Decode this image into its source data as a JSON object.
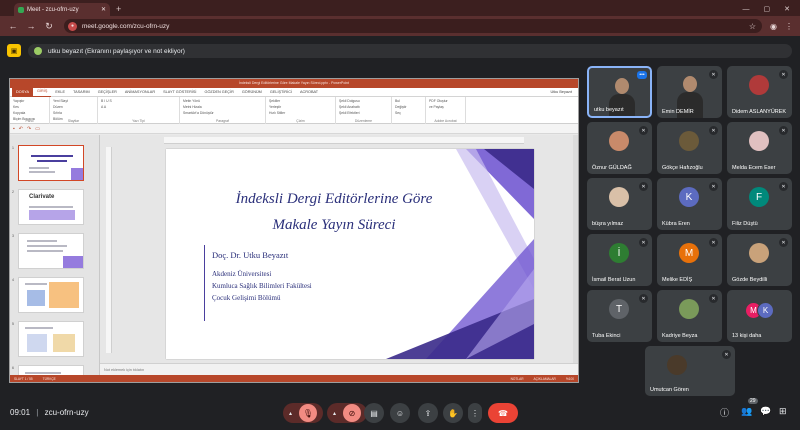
{
  "browser": {
    "tab_title": "Meet - zcu-ofrn-uzy",
    "url": "meet.google.com/zcu-ofrn-uzy",
    "new_tab": "+",
    "minimize": "—",
    "maximize": "▢",
    "close": "✕"
  },
  "banner": {
    "text": "utku beyazıt (Ekranını paylaşıyor ve not ekliyor)"
  },
  "ppt": {
    "window_title": "İndeksli Dergi Editörlerine Göre Makale Yayın Süreci.pptx - PowerPoint",
    "tabs": [
      "DOSYA",
      "GİRİŞ",
      "EKLE",
      "TASARIM",
      "GEÇİŞLER",
      "ANİMASYONLAR",
      "SLAYT GÖSTERİSİ",
      "GÖZDEN GEÇİR",
      "GÖRÜNÜM",
      "GELİŞTİRİCİ",
      "ACROBAT"
    ],
    "user": "Utku Beyazıt",
    "ribbon_groups": [
      {
        "label": "Pano",
        "items": [
          "Yapıştır",
          "Kes",
          "Kopyala",
          "Biçim Boyacısı"
        ]
      },
      {
        "label": "Slaytlar",
        "items": [
          "Yeni Slayt",
          "Düzen",
          "Sıfırla",
          "Bölüm"
        ]
      },
      {
        "label": "Yazı Tipi",
        "items": [
          "B  I  U  S",
          "A  A"
        ]
      },
      {
        "label": "Paragraf",
        "items": [
          "Metin Yönü",
          "Metni Hizala",
          "SmartArt'a Dönüştür"
        ]
      },
      {
        "label": "Çizim",
        "items": [
          "Şekiller",
          "Yerleştir",
          "Hızlı Stiller"
        ]
      },
      {
        "label": "Düzenleme",
        "items": [
          "Şekil Dolgusu",
          "Şekil Anahattı",
          "Şekil Efektleri"
        ]
      },
      {
        "label": "",
        "items": [
          "Bul",
          "Değiştir",
          "Seç"
        ]
      },
      {
        "label": "Adobe Acrobat",
        "items": [
          "PDF Oluştur",
          "ve Paylaş"
        ]
      }
    ],
    "slide": {
      "title_line1": "İndeksli Dergi Editörlerine Göre",
      "title_line2": "Makale Yayın Süreci",
      "author": "Doç. Dr. Utku Beyazıt",
      "inst_line1": "Akdeniz Üniversitesi",
      "inst_line2": "Kumluca Sağlık Bilimleri Fakültesi",
      "inst_line3": "Çocuk Gelişimi Bölümü"
    },
    "thumb_nums": [
      "1",
      "2",
      "3",
      "4",
      "5",
      "6"
    ],
    "thumb2_brand": "Clarivate",
    "notes_placeholder": "Not eklemek için tıklatın",
    "status_left": "SLAYT 1 / 55",
    "status_lang": "TÜRKÇE",
    "status_notes": "NOTLAR",
    "status_comments": "AÇIKLAMALAR",
    "status_zoom": "%100"
  },
  "participants": [
    {
      "name": "utku beyazıt",
      "type": "video",
      "muted": false
    },
    {
      "name": "Emin DEMİR",
      "type": "video",
      "muted": true
    },
    {
      "name": "Didem ASLANYÜREK",
      "type": "photo",
      "muted": true,
      "color": "#b03a3a"
    },
    {
      "name": "Öznur GÜLDAĞ",
      "type": "photo",
      "muted": true,
      "color": "#c98a6a"
    },
    {
      "name": "Gökçe Hafızoğlu",
      "type": "photo",
      "muted": true,
      "color": "#6b5a3a"
    },
    {
      "name": "Melda Ecem Eser",
      "type": "photo",
      "muted": true,
      "color": "#e0c0c0"
    },
    {
      "name": "büşra yılmaz",
      "type": "photo",
      "muted": true,
      "color": "#d9c0a8"
    },
    {
      "name": "Kübra Eren",
      "type": "letter",
      "letter": "K",
      "muted": true,
      "color": "#5c6bc0"
    },
    {
      "name": "Filiz Düştü",
      "type": "letter",
      "letter": "F",
      "muted": true,
      "color": "#00897b"
    },
    {
      "name": "İsmail Berat Uzun",
      "type": "letter",
      "letter": "İ",
      "muted": true,
      "color": "#2e7d32"
    },
    {
      "name": "Melike EDİŞ",
      "type": "letter",
      "letter": "M",
      "muted": true,
      "color": "#e8710a"
    },
    {
      "name": "Gözde Beydilli",
      "type": "photo",
      "muted": true,
      "color": "#c9a27a"
    },
    {
      "name": "Tuba Ekinci",
      "type": "letter",
      "letter": "T",
      "muted": true,
      "color": "#5f6368"
    },
    {
      "name": "Kadriye Beyza",
      "type": "photo",
      "muted": true,
      "color": "#7a9a5a"
    },
    {
      "name": "13 kişi daha",
      "type": "stack",
      "letters": [
        "M",
        "K"
      ],
      "colors": [
        "#e91e63",
        "#5c6bc0"
      ],
      "muted": false
    },
    {
      "name": "Umutcan Gören",
      "type": "photo",
      "muted": true,
      "color": "#4a3a2a"
    }
  ],
  "bottom": {
    "clock": "09:01",
    "separator": "|",
    "meeting_code": "zcu-ofrn-uzy",
    "participant_count": "29"
  }
}
